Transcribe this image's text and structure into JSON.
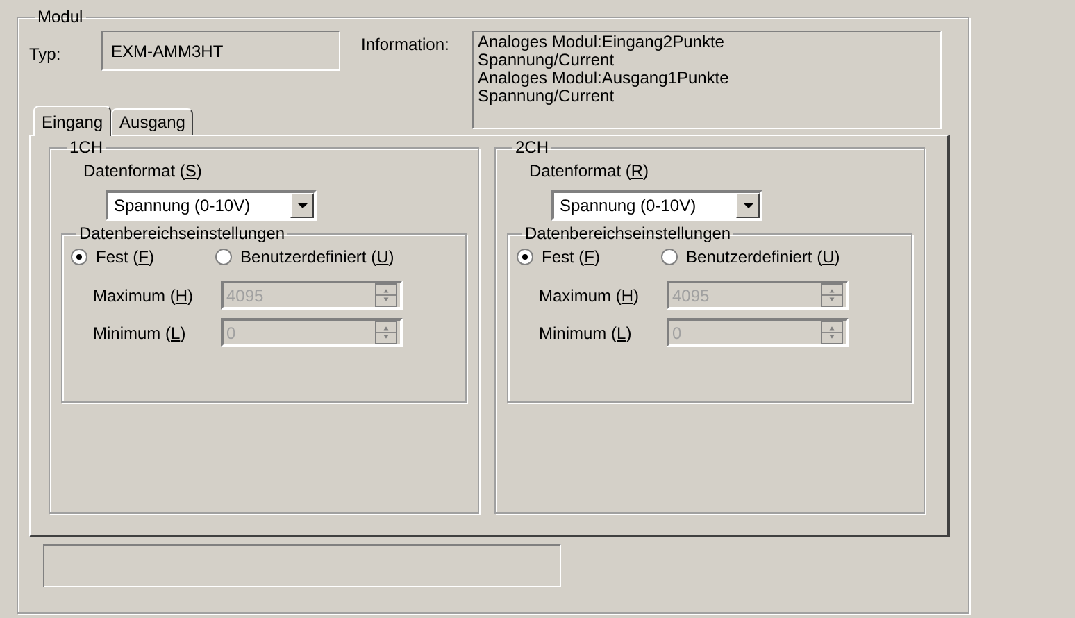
{
  "module": {
    "title": "Modul",
    "type_label": "Typ:",
    "type_value": "EXM-AMM3HT",
    "info_label": "Information:",
    "info_lines": [
      "Analoges Modul:Eingang2Punkte",
      "Spannung/Current",
      "Analoges Modul:Ausgang1Punkte",
      "Spannung/Current"
    ]
  },
  "tabs": [
    {
      "label": "Eingang",
      "selected": true
    },
    {
      "label": "Ausgang",
      "selected": false
    }
  ],
  "channels": [
    {
      "title": "1CH",
      "format_label": {
        "before": "Datenformat (",
        "accel": "S",
        "after": ")"
      },
      "format_value": "Spannung (0-10V)",
      "range_title": "Datenbereichseinstellungen",
      "radios": [
        {
          "before": "Fest (",
          "accel": "F",
          "after": ")",
          "selected": true
        },
        {
          "before": "Benutzerdefiniert (",
          "accel": "U",
          "after": ")",
          "selected": false
        }
      ],
      "fields": [
        {
          "before": "Maximum (",
          "accel": "H",
          "after": ")",
          "value": "4095",
          "disabled": true
        },
        {
          "before": "Minimum (",
          "accel": "L",
          "after": ")",
          "value": "0",
          "disabled": true
        }
      ]
    },
    {
      "title": "2CH",
      "format_label": {
        "before": "Datenformat (",
        "accel": "R",
        "after": ")"
      },
      "format_value": "Spannung (0-10V)",
      "range_title": "Datenbereichseinstellungen",
      "radios": [
        {
          "before": "Fest (",
          "accel": "F",
          "after": ")",
          "selected": true
        },
        {
          "before": "Benutzerdefiniert (",
          "accel": "U",
          "after": ")",
          "selected": false
        }
      ],
      "fields": [
        {
          "before": "Maximum (",
          "accel": "H",
          "after": ")",
          "value": "4095",
          "disabled": true
        },
        {
          "before": "Minimum (",
          "accel": "L",
          "after": ")",
          "value": "0",
          "disabled": true
        }
      ]
    }
  ]
}
